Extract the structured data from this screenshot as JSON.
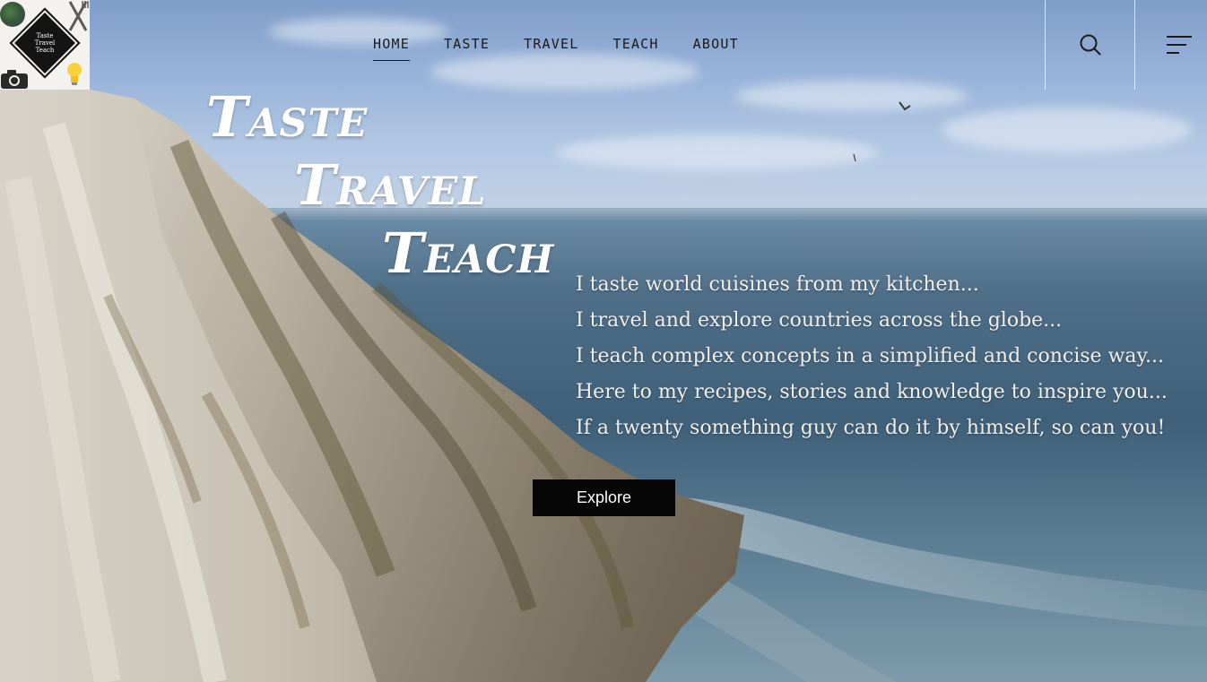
{
  "logo": {
    "text_line1": "Taste",
    "text_line2": "Travel",
    "text_line3": "Teach"
  },
  "nav": {
    "items": [
      {
        "label": "HOME",
        "active": true
      },
      {
        "label": "TASTE",
        "active": false
      },
      {
        "label": "TRAVEL",
        "active": false
      },
      {
        "label": "TEACH",
        "active": false
      },
      {
        "label": "ABOUT",
        "active": false
      }
    ],
    "search_icon": "search-icon",
    "menu_icon": "menu-icon"
  },
  "hero": {
    "title_line1": "Taste",
    "title_line2": "Travel",
    "title_line3": "Teach"
  },
  "tagline": [
    "I taste world cuisines from my kitchen...",
    "I travel and explore countries across the globe...",
    "I teach complex concepts in a simplified and concise way...",
    "Here to my recipes, stories and knowledge to inspire you...",
    "If a twenty something guy can do it by himself, so can you!"
  ],
  "cta": {
    "label": "Explore"
  },
  "colors": {
    "button_bg": "#060606",
    "hero_text": "#ffffff",
    "nav_text": "#1b1b1b"
  }
}
